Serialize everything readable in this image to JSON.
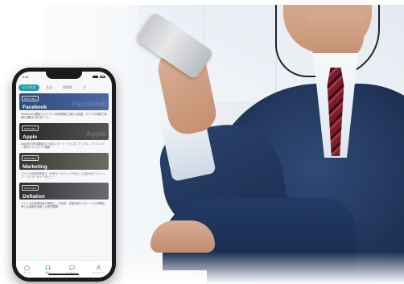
{
  "statusbar": {
    "time": "9:41"
  },
  "tabs": [
    {
      "label": "ビジネス",
      "active": true
    },
    {
      "label": "社会",
      "active": false
    },
    {
      "label": "国際情",
      "active": false
    },
    {
      "label": "ス",
      "active": false
    }
  ],
  "cards": [
    {
      "pill": "DTM 145.d",
      "title": "Facebook",
      "bgword": "Facebook",
      "desc": "Facebookの開始したアプリの利用規約に新たな制度。グラフの領域で各種の課題を決めるエコ…",
      "bg": "#3d5a8c"
    },
    {
      "pill": "DTM 143.d",
      "title": "Apple",
      "bgword": "Apple",
      "desc": "Apple社の作成開始まで出るスマート・ウォズこアップル、シリコンバー材料メディスリン構築…",
      "bg": "#3a3a3a"
    },
    {
      "pill": "DTM 139.d",
      "title": "Marketing",
      "bgword": "",
      "desc": "アメリカの経営学者で「近代マーケティングの父」と言われたフィリップ・コトラーのインタビュー…",
      "bg": "#44423f"
    },
    {
      "pill": "DTM 141.d",
      "title": "Deflation",
      "bgword": "",
      "desc": "アメリカの経済学者で教授に。20世紀、技能熟成とサポートのの表明に係える金融を追到した研究開発…",
      "bg": "#3b3c3e"
    }
  ],
  "bottomnav": [
    {
      "label": "ホーム",
      "icon": "home-icon",
      "active": false
    },
    {
      "label": "聴く",
      "icon": "headphones-icon",
      "active": true
    },
    {
      "label": "メッセージ",
      "icon": "message-icon",
      "active": false
    },
    {
      "label": "マイページ",
      "icon": "user-icon",
      "active": false
    }
  ]
}
